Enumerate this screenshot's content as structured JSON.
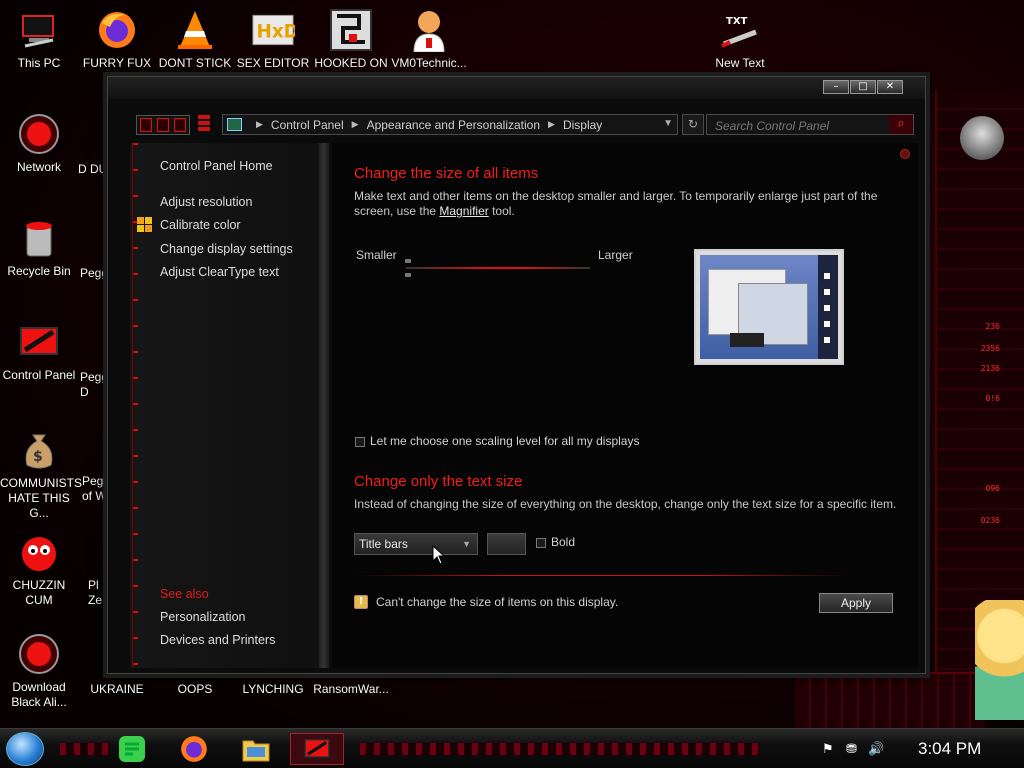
{
  "desktop": {
    "top_icons": [
      {
        "label": "This PC",
        "icon": "computer-icon"
      },
      {
        "label": "FURRY FUX",
        "icon": "firefox-icon"
      },
      {
        "label": "DONT STICK",
        "icon": "vlc-icon"
      },
      {
        "label": "SEX EDITOR",
        "icon": "hxd-icon"
      },
      {
        "label": "HOOKED ON",
        "icon": "maze-icon"
      },
      {
        "label": "VM0Technic...",
        "icon": "doctor-icon"
      },
      {
        "label": "New Text",
        "icon": "text-file-icon"
      }
    ],
    "left_icons": [
      {
        "label": "Network",
        "icon": "alienware-icon"
      },
      {
        "label": "Recycle Bin",
        "icon": "recycle-bin-icon"
      },
      {
        "label": "Control Panel",
        "icon": "control-panel-icon"
      },
      {
        "label": "COMMUNISTS HATE THIS G...",
        "icon": "money-bag-icon"
      },
      {
        "label": "CHUZZIN CUM",
        "icon": "chuzzle-icon"
      },
      {
        "label": "Download Black Ali...",
        "icon": "alienware-icon"
      }
    ],
    "partial_icons": [
      "D DU",
      "Pegg",
      "Pegg D",
      "Pega of W",
      "Pl Ze"
    ],
    "bottom_icons": [
      {
        "label": "UKRAINE"
      },
      {
        "label": "OOPS"
      },
      {
        "label": "LYNCHING"
      },
      {
        "label": "RansomWar..."
      }
    ],
    "deco_texts": [
      "236",
      "2356",
      "2136",
      "0!6",
      "096",
      "0236"
    ]
  },
  "window": {
    "address": {
      "crumbs": [
        "Control Panel",
        "Appearance and Personalization",
        "Display"
      ]
    },
    "search": {
      "placeholder": "Search Control Panel"
    },
    "sidebar": {
      "home": "Control Panel Home",
      "links": [
        "Adjust resolution",
        "Calibrate color",
        "Change display settings",
        "Adjust ClearType text"
      ],
      "see_also": "See also",
      "see_also_links": [
        "Personalization",
        "Devices and Printers"
      ]
    },
    "main": {
      "heading1": "Change the size of all items",
      "para1_part1": "Make text and other items on the desktop smaller and larger. To temporarily enlarge just part of the screen, use the ",
      "para1_link": "Magnifier",
      "para1_part2": " tool.",
      "smaller": "Smaller",
      "larger": "Larger",
      "scaling_checkbox": "Let me choose one scaling level for all my displays",
      "heading2": "Change only the text size",
      "para2": "Instead of changing the size of everything on the desktop, change only the text size for a specific item.",
      "item_select": "Title bars",
      "bold_label": "Bold",
      "warning": "Can't change the size of items on this display.",
      "apply": "Apply"
    }
  },
  "taskbar": {
    "clock": "3:04 PM"
  }
}
